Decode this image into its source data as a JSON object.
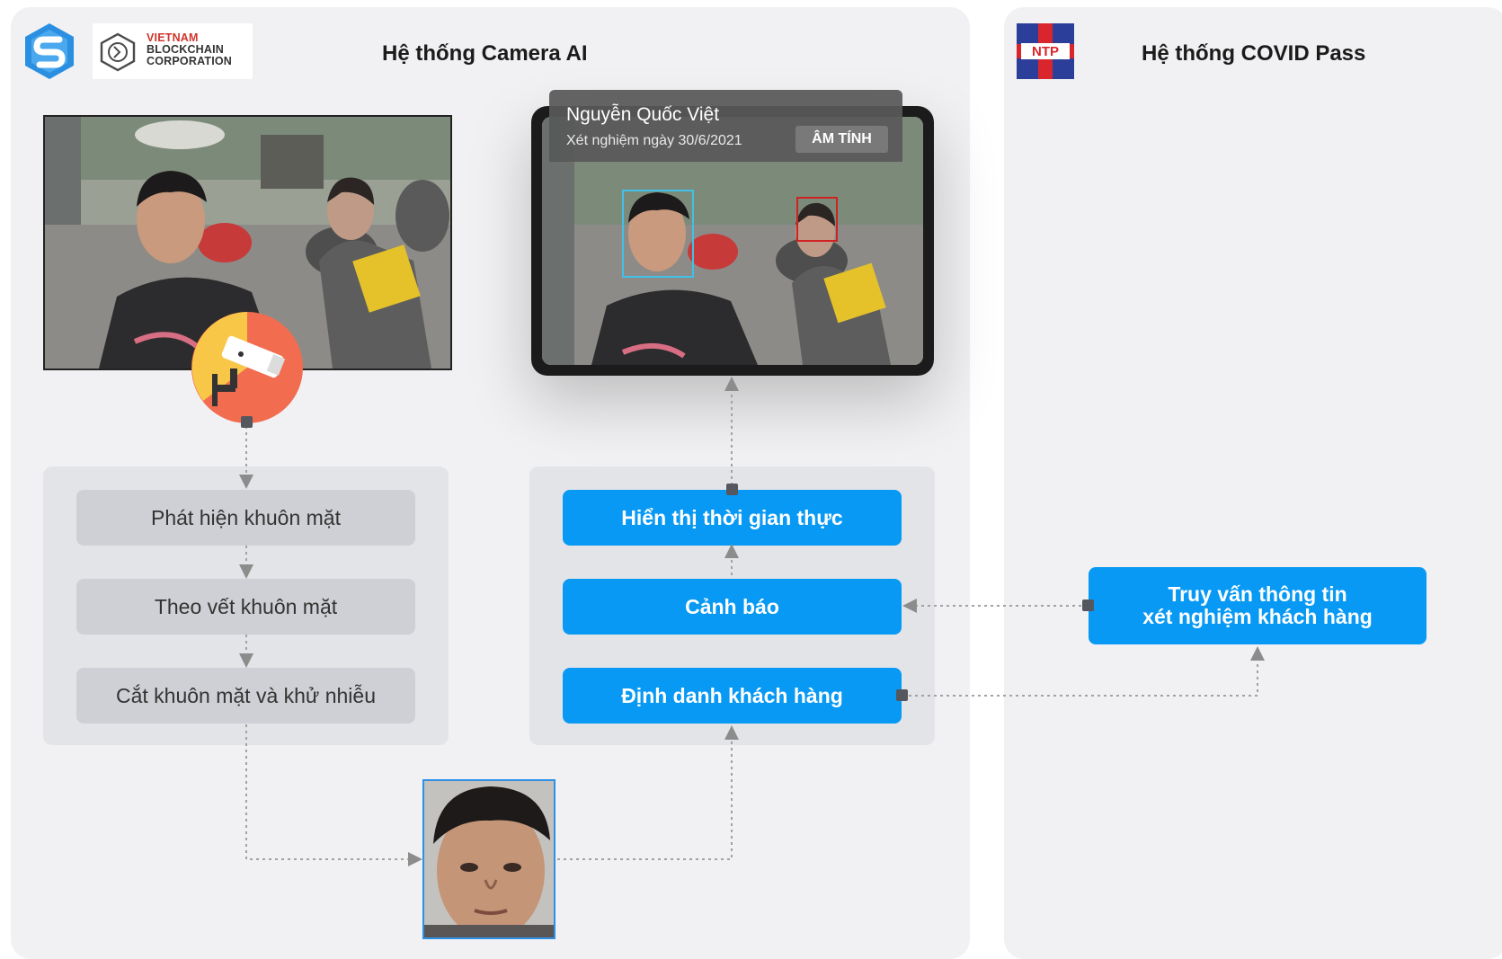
{
  "colors": {
    "panel_bg": "#f1f1f3",
    "group_bg": "#e3e4e8",
    "gray_step": "#cfd0d5",
    "accent_blue": "#0799f4",
    "connector": "#9a9a9a",
    "connector_node": "#55575e",
    "face_box_blue": "#41c0e8",
    "face_box_red": "#d02222",
    "camera_circle": "#f26c4f",
    "camera_circle_accent": "#f9c748"
  },
  "left_system": {
    "title": "Hệ thống Camera AI",
    "logo_icon": "s-hexagon-logo",
    "partner_logo": {
      "line1": "VIETNAM",
      "line2": "BLOCKCHAIN",
      "line3": "CORPORATION"
    }
  },
  "right_system": {
    "title": "Hệ thống COVID Pass",
    "logo_text": "NTP"
  },
  "recognition_card": {
    "name": "Nguyễn Quốc Việt",
    "test_date": "Xét nghiệm ngày 30/6/2021",
    "result_badge": "ÂM TÍNH"
  },
  "processing_steps": [
    {
      "label": "Phát hiện khuôn mặt"
    },
    {
      "label": "Theo vết khuôn mặt"
    },
    {
      "label": "Cắt khuôn mặt và khử nhiễu"
    }
  ],
  "output_steps": [
    {
      "label": "Hiển thị thời gian thực"
    },
    {
      "label": "Cảnh báo"
    },
    {
      "label": "Định danh khách hàng"
    }
  ],
  "covid_query": {
    "line1": "Truy vấn thông tin",
    "line2": "xét nghiệm khách hàng"
  },
  "icons": [
    "s-hexagon-logo",
    "vbc-logo",
    "ntp-logo",
    "security-camera-icon"
  ]
}
